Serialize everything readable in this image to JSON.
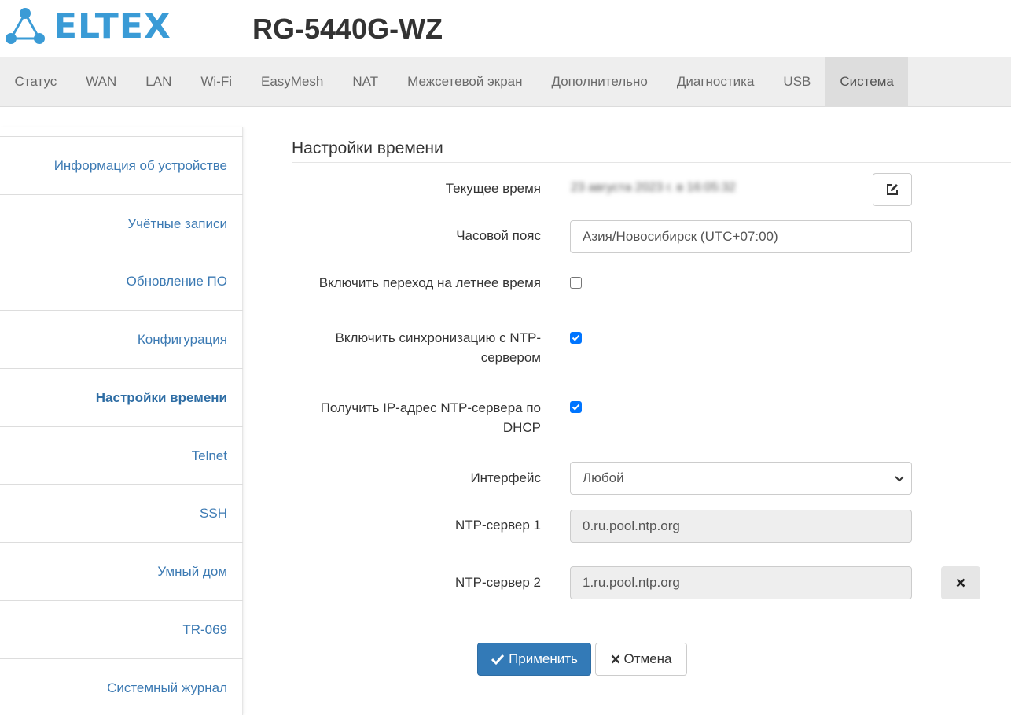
{
  "header": {
    "logo_text": "ELTEX",
    "model": "RG-5440G-WZ"
  },
  "topnav": {
    "tabs": [
      {
        "label": "Статус"
      },
      {
        "label": "WAN"
      },
      {
        "label": "LAN"
      },
      {
        "label": "Wi-Fi"
      },
      {
        "label": "EasyMesh"
      },
      {
        "label": "NAT"
      },
      {
        "label": "Межсетевой экран"
      },
      {
        "label": "Дополнительно"
      },
      {
        "label": "Диагностика"
      },
      {
        "label": "USB"
      },
      {
        "label": "Система"
      }
    ],
    "active": "Система"
  },
  "sidebar": {
    "items": [
      {
        "label": "Информация об устройстве"
      },
      {
        "label": "Учётные записи"
      },
      {
        "label": "Обновление ПО"
      },
      {
        "label": "Конфигурация"
      },
      {
        "label": "Настройки времени"
      },
      {
        "label": "Telnet"
      },
      {
        "label": "SSH"
      },
      {
        "label": "Умный дом"
      },
      {
        "label": "TR-069"
      },
      {
        "label": "Системный журнал"
      }
    ],
    "active": "Настройки времени"
  },
  "main": {
    "title": "Настройки времени",
    "current_time": {
      "label": "Текущее время",
      "value": "23 августа 2023 г. в 16:05:32",
      "edit_icon": "edit-icon"
    },
    "timezone": {
      "label": "Часовой пояс",
      "value": "Азия/Новосибирск (UTC+07:00)"
    },
    "dst": {
      "label": "Включить переход на летнее время",
      "checked": false
    },
    "ntp_sync": {
      "label_line1": "Включить синхронизацию с NTP-",
      "label_line2": "сервером",
      "checked": true
    },
    "ntp_dhcp": {
      "label_line1": "Получить IP-адрес NTP-сервера по",
      "label_line2": "DHCP",
      "checked": true
    },
    "interface": {
      "label": "Интерфейс",
      "value": "Любой"
    },
    "ntp_server_1": {
      "label": "NTP-сервер 1",
      "value": "0.ru.pool.ntp.org"
    },
    "ntp_server_2": {
      "label": "NTP-сервер 2",
      "value": "1.ru.pool.ntp.org",
      "remove_icon": "close-icon"
    },
    "apply_label": "Применить",
    "cancel_label": "Отмена"
  },
  "colors": {
    "brand": "#3a9bd6",
    "link": "#3c7ab3",
    "primary": "#337ab7",
    "checkbox": "#0075ff"
  }
}
